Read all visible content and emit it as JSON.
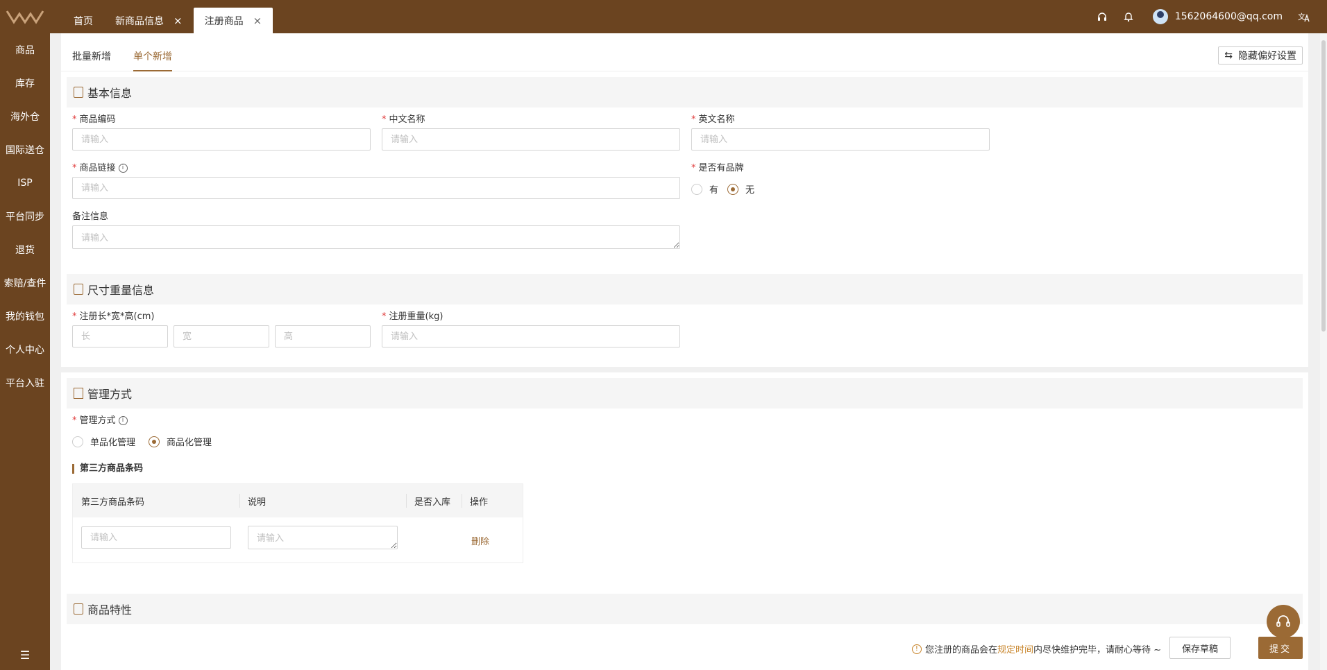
{
  "topbar": {
    "tabs": [
      {
        "label": "首页",
        "closable": false
      },
      {
        "label": "新商品信息",
        "closable": true
      },
      {
        "label": "注册商品",
        "closable": true,
        "active": true
      }
    ],
    "user_email": "1562064600@qq.com",
    "icons": [
      "headset-icon",
      "bell-icon",
      "avatar",
      "translate-icon"
    ]
  },
  "sidebar": {
    "items": [
      "商品",
      "库存",
      "海外仓",
      "国际送仓",
      "ISP",
      "平台同步",
      "退货",
      "索赔/查件",
      "我的钱包",
      "个人中心",
      "平台入驻"
    ],
    "collapse_icon": "menu-collapse-icon"
  },
  "subtabs": {
    "batch": "批量新增",
    "single": "单个新增",
    "pref_button": "隐藏偏好设置"
  },
  "basic": {
    "title": "基本信息",
    "sku_label": "商品编码",
    "cn_name_label": "中文名称",
    "en_name_label": "英文名称",
    "link_label": "商品链接",
    "brand_label": "是否有品牌",
    "brand_yes": "有",
    "brand_no": "无",
    "remark_label": "备注信息",
    "placeholder": "请输入"
  },
  "size": {
    "title": "尺寸重量信息",
    "dims_label": "注册长*宽*高(cm)",
    "len_ph": "长",
    "wid_ph": "宽",
    "hei_ph": "高",
    "weight_label": "注册重量(kg)",
    "placeholder": "请输入"
  },
  "manage": {
    "title": "管理方式",
    "mode_label": "管理方式",
    "opt_single": "单品化管理",
    "opt_product": "商品化管理",
    "barcode_title": "第三方商品条码",
    "table": {
      "headers": [
        "第三方商品条码",
        "说明",
        "是否入库",
        "操作"
      ],
      "row": {
        "barcode_ph": "请输入",
        "desc_ph": "请输入",
        "action": "删除"
      }
    }
  },
  "features": {
    "title": "商品特性"
  },
  "footer": {
    "note_prefix": "您注册的商品会在",
    "note_highlight": "规定时间",
    "note_suffix": "内尽快维护完毕，请耐心等待 ~",
    "save_draft": "保存草稿",
    "submit": "提交"
  },
  "colors": {
    "brand": "#6b4420",
    "accent": "#9b6a35",
    "required": "#e03c3c"
  }
}
